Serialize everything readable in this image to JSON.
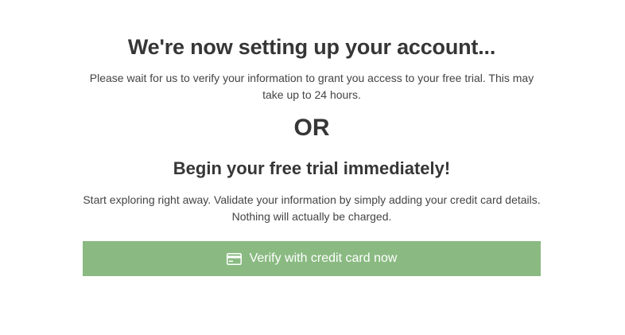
{
  "setup": {
    "title": "We're now setting up your account...",
    "message": "Please wait for us to verify your information to grant you access to your free trial. This may take up to 24 hours.",
    "separator": "OR"
  },
  "trial": {
    "title": "Begin your free trial immediately!",
    "message": "Start exploring right away. Validate your information by simply adding your credit card details. Nothing will actually be charged.",
    "button_label": "Verify with credit card now",
    "button_icon": "credit-card-icon",
    "button_color": "#8aba82"
  }
}
